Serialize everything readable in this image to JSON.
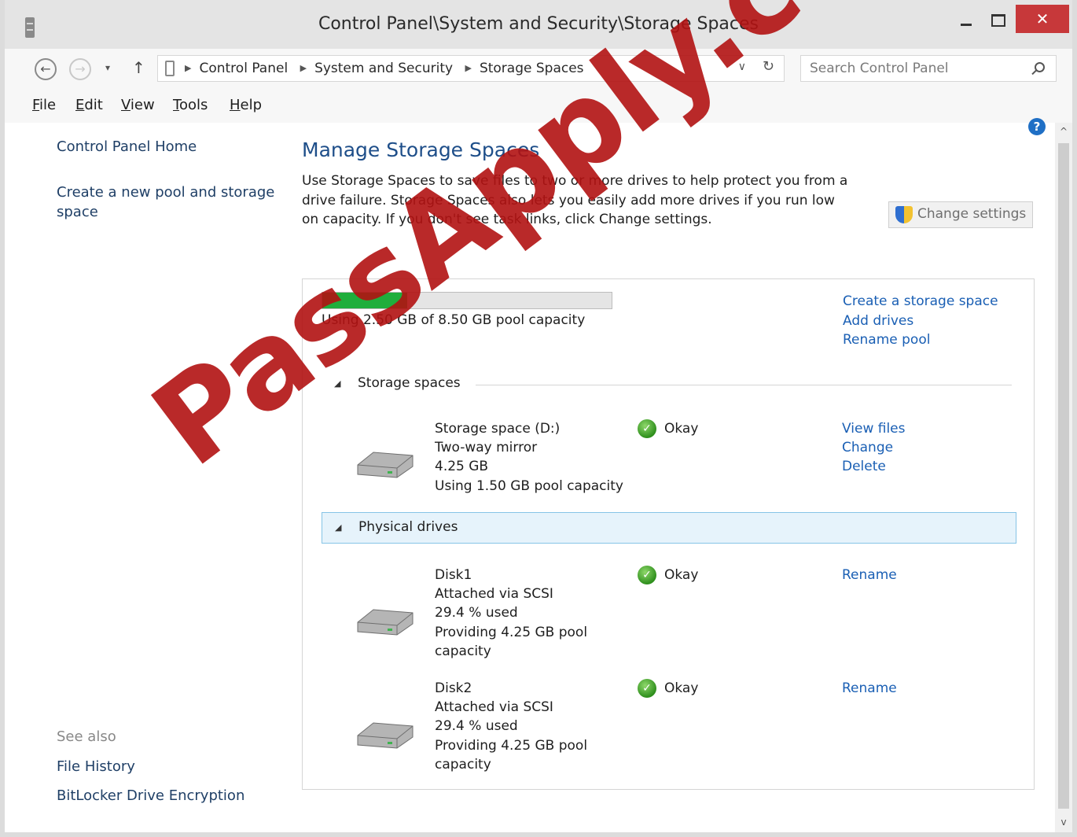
{
  "window": {
    "title": "Control Panel\\System and Security\\Storage Spaces",
    "minimize_glyph": "",
    "maximize_glyph": "",
    "close_glyph": "✕"
  },
  "nav": {
    "back_glyph": "←",
    "forward_glyph": "→",
    "recent_glyph": "▾",
    "up_glyph": "↑",
    "breadcrumbs": [
      "Control Panel",
      "System and Security",
      "Storage Spaces"
    ],
    "dropdown_glyph": "∨",
    "refresh_glyph": "↻",
    "search_placeholder": "Search Control Panel"
  },
  "menu": {
    "items": [
      {
        "underline": "F",
        "rest": "ile"
      },
      {
        "underline": "E",
        "rest": "dit"
      },
      {
        "underline": "V",
        "rest": "iew"
      },
      {
        "underline": "T",
        "rest": "ools"
      },
      {
        "underline": "H",
        "rest": "elp"
      }
    ]
  },
  "sidebar": {
    "home": "Control Panel Home",
    "create_pool_line1": "Create a new pool and storage",
    "create_pool_line2": "space",
    "see_also": "See also",
    "file_history": "File History",
    "bitlocker": "BitLocker Drive Encryption"
  },
  "main": {
    "title": "Manage Storage Spaces",
    "description": "Use Storage Spaces to save files to two or more drives to help protect you from a drive failure. Storage Spaces also lets you easily add more drives if you run low on capacity. If you don't see task links, click Change settings.",
    "change_settings": "Change settings",
    "help_glyph": "?",
    "scroll_up_glyph": "^",
    "scroll_down_glyph": "v"
  },
  "pool": {
    "used_fraction": 0.294,
    "usage_text": "Using 2.50 GB of 8.50 GB pool capacity",
    "links": [
      "Create a storage space",
      "Add drives",
      "Rename pool"
    ],
    "storage_spaces_label": "Storage spaces",
    "physical_drives_label": "Physical drives",
    "collapse_glyph": "◢",
    "spaces": [
      {
        "name": "Storage space (D:)",
        "resiliency": "Two-way mirror",
        "size": "4.25 GB",
        "usage": "Using 1.50 GB pool capacity",
        "status": "Okay",
        "links": [
          "View files",
          "Change",
          "Delete"
        ]
      }
    ],
    "drives": [
      {
        "name": "Disk1",
        "connection": "Attached via SCSI",
        "used": "29.4 % used",
        "providing_line1": "Providing 4.25 GB pool",
        "providing_line2": "capacity",
        "status": "Okay",
        "rename": "Rename"
      },
      {
        "name": "Disk2",
        "connection": "Attached via SCSI",
        "used": "29.4 % used",
        "providing_line1": "Providing 4.25 GB pool",
        "providing_line2": "capacity",
        "status": "Okay",
        "rename": "Rename"
      }
    ]
  },
  "watermark": "PassApply.com",
  "icons": {
    "app": "control-panel-icon",
    "shield": "uac-shield-icon",
    "drive": "hard-drive-icon",
    "ok": "checkmark-icon",
    "search": "search-icon",
    "help": "help-icon"
  },
  "colors": {
    "accent": "#1a5fb4",
    "title": "#1e4e89",
    "progress": "#1fae3c",
    "close": "#c7383a",
    "selection": "#e6f3fb",
    "watermark": "#b11212"
  }
}
